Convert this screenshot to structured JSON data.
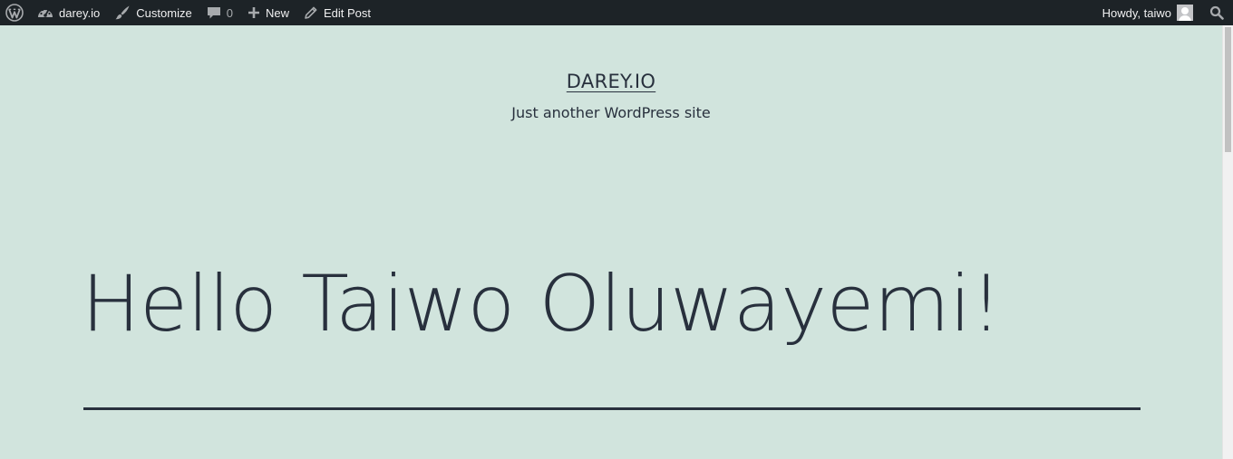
{
  "adminbar": {
    "wp_logo_icon": "wordpress-logo-icon",
    "site_name": "darey.io",
    "site_icon": "dashboard-gauge-icon",
    "customize_label": "Customize",
    "customize_icon": "paintbrush-icon",
    "comments_count": "0",
    "comments_icon": "comment-bubble-icon",
    "new_label": "New",
    "new_icon": "plus-icon",
    "edit_label": "Edit Post",
    "edit_icon": "pencil-icon",
    "howdy": "Howdy, taiwo",
    "search_icon": "search-icon"
  },
  "site": {
    "title": "DAREY.IO",
    "description": "Just another WordPress site"
  },
  "post": {
    "title": "Hello Taiwo Oluwayemi!"
  },
  "colors": {
    "adminbar_bg": "#1d2327",
    "page_bg": "#d1e4dd",
    "text": "#28303d"
  }
}
